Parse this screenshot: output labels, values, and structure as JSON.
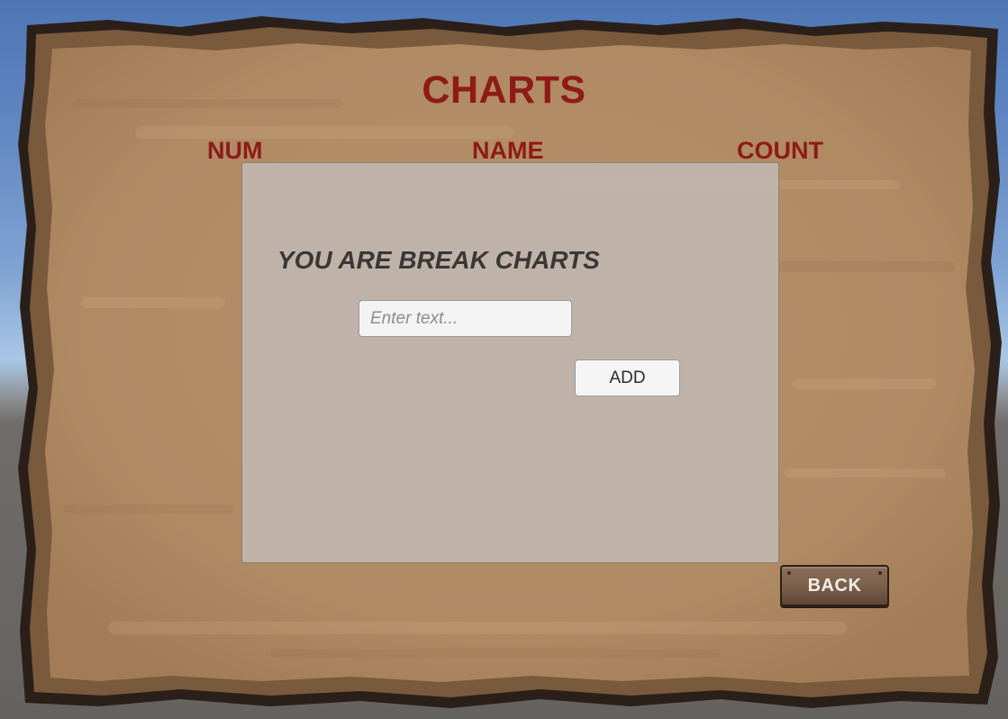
{
  "screen": {
    "title": "CHARTS",
    "columns": {
      "num": "NUM",
      "name": "NAME",
      "count": "COUNT"
    }
  },
  "dialog": {
    "message": "YOU ARE BREAK CHARTS",
    "input": {
      "placeholder": "Enter text...",
      "value": ""
    },
    "add_label": "ADD"
  },
  "back_label": "BACK",
  "colors": {
    "title_red": "#8e1b17",
    "parchment": "#b08c66",
    "parchment_border": "#7a5a3c",
    "dialog_panel": "#bfb6ae",
    "back_button": "#7a5f4a"
  }
}
